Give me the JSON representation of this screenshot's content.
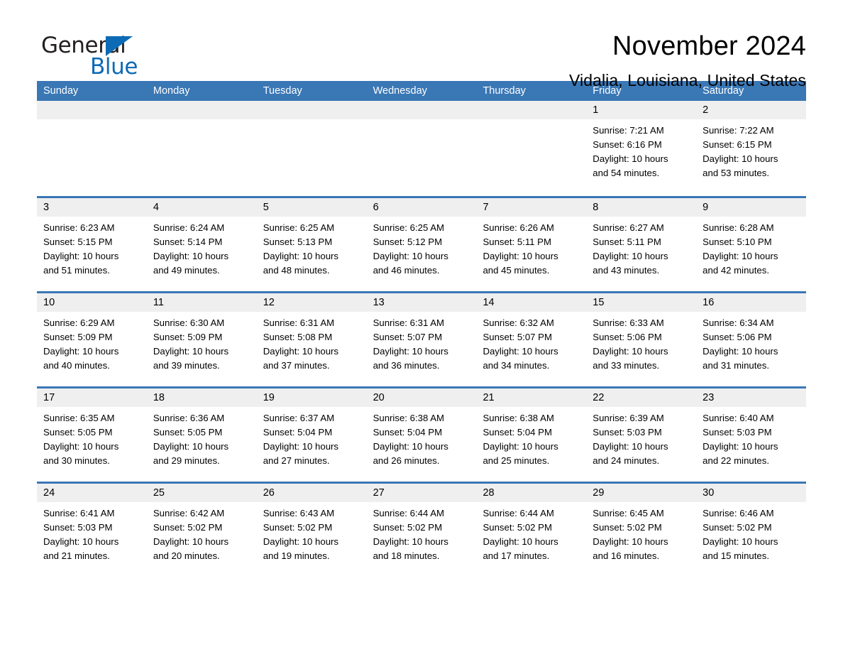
{
  "logo": {
    "word_one": "General",
    "word_two": "Blue",
    "triangle_icon": "blue-triangle-icon",
    "colors": {
      "black": "#231f20",
      "blue": "#0d6bb5"
    }
  },
  "header": {
    "title": "November 2024",
    "location": "Vidalia, Louisiana, United States"
  },
  "theme": {
    "header_bg": "#3a77b5",
    "header_text": "#ffffff",
    "daynum_bg": "#efefef",
    "cell_bg": "#ffffff",
    "text": "#000000"
  },
  "calendar": {
    "weekday_headers": [
      "Sunday",
      "Monday",
      "Tuesday",
      "Wednesday",
      "Thursday",
      "Friday",
      "Saturday"
    ],
    "weeks": [
      [
        {
          "day": "",
          "lines": []
        },
        {
          "day": "",
          "lines": []
        },
        {
          "day": "",
          "lines": []
        },
        {
          "day": "",
          "lines": []
        },
        {
          "day": "",
          "lines": []
        },
        {
          "day": "1",
          "lines": [
            "Sunrise: 7:21 AM",
            "Sunset: 6:16 PM",
            "Daylight: 10 hours",
            "and 54 minutes."
          ]
        },
        {
          "day": "2",
          "lines": [
            "Sunrise: 7:22 AM",
            "Sunset: 6:15 PM",
            "Daylight: 10 hours",
            "and 53 minutes."
          ]
        }
      ],
      [
        {
          "day": "3",
          "lines": [
            "Sunrise: 6:23 AM",
            "Sunset: 5:15 PM",
            "Daylight: 10 hours",
            "and 51 minutes."
          ]
        },
        {
          "day": "4",
          "lines": [
            "Sunrise: 6:24 AM",
            "Sunset: 5:14 PM",
            "Daylight: 10 hours",
            "and 49 minutes."
          ]
        },
        {
          "day": "5",
          "lines": [
            "Sunrise: 6:25 AM",
            "Sunset: 5:13 PM",
            "Daylight: 10 hours",
            "and 48 minutes."
          ]
        },
        {
          "day": "6",
          "lines": [
            "Sunrise: 6:25 AM",
            "Sunset: 5:12 PM",
            "Daylight: 10 hours",
            "and 46 minutes."
          ]
        },
        {
          "day": "7",
          "lines": [
            "Sunrise: 6:26 AM",
            "Sunset: 5:11 PM",
            "Daylight: 10 hours",
            "and 45 minutes."
          ]
        },
        {
          "day": "8",
          "lines": [
            "Sunrise: 6:27 AM",
            "Sunset: 5:11 PM",
            "Daylight: 10 hours",
            "and 43 minutes."
          ]
        },
        {
          "day": "9",
          "lines": [
            "Sunrise: 6:28 AM",
            "Sunset: 5:10 PM",
            "Daylight: 10 hours",
            "and 42 minutes."
          ]
        }
      ],
      [
        {
          "day": "10",
          "lines": [
            "Sunrise: 6:29 AM",
            "Sunset: 5:09 PM",
            "Daylight: 10 hours",
            "and 40 minutes."
          ]
        },
        {
          "day": "11",
          "lines": [
            "Sunrise: 6:30 AM",
            "Sunset: 5:09 PM",
            "Daylight: 10 hours",
            "and 39 minutes."
          ]
        },
        {
          "day": "12",
          "lines": [
            "Sunrise: 6:31 AM",
            "Sunset: 5:08 PM",
            "Daylight: 10 hours",
            "and 37 minutes."
          ]
        },
        {
          "day": "13",
          "lines": [
            "Sunrise: 6:31 AM",
            "Sunset: 5:07 PM",
            "Daylight: 10 hours",
            "and 36 minutes."
          ]
        },
        {
          "day": "14",
          "lines": [
            "Sunrise: 6:32 AM",
            "Sunset: 5:07 PM",
            "Daylight: 10 hours",
            "and 34 minutes."
          ]
        },
        {
          "day": "15",
          "lines": [
            "Sunrise: 6:33 AM",
            "Sunset: 5:06 PM",
            "Daylight: 10 hours",
            "and 33 minutes."
          ]
        },
        {
          "day": "16",
          "lines": [
            "Sunrise: 6:34 AM",
            "Sunset: 5:06 PM",
            "Daylight: 10 hours",
            "and 31 minutes."
          ]
        }
      ],
      [
        {
          "day": "17",
          "lines": [
            "Sunrise: 6:35 AM",
            "Sunset: 5:05 PM",
            "Daylight: 10 hours",
            "and 30 minutes."
          ]
        },
        {
          "day": "18",
          "lines": [
            "Sunrise: 6:36 AM",
            "Sunset: 5:05 PM",
            "Daylight: 10 hours",
            "and 29 minutes."
          ]
        },
        {
          "day": "19",
          "lines": [
            "Sunrise: 6:37 AM",
            "Sunset: 5:04 PM",
            "Daylight: 10 hours",
            "and 27 minutes."
          ]
        },
        {
          "day": "20",
          "lines": [
            "Sunrise: 6:38 AM",
            "Sunset: 5:04 PM",
            "Daylight: 10 hours",
            "and 26 minutes."
          ]
        },
        {
          "day": "21",
          "lines": [
            "Sunrise: 6:38 AM",
            "Sunset: 5:04 PM",
            "Daylight: 10 hours",
            "and 25 minutes."
          ]
        },
        {
          "day": "22",
          "lines": [
            "Sunrise: 6:39 AM",
            "Sunset: 5:03 PM",
            "Daylight: 10 hours",
            "and 24 minutes."
          ]
        },
        {
          "day": "23",
          "lines": [
            "Sunrise: 6:40 AM",
            "Sunset: 5:03 PM",
            "Daylight: 10 hours",
            "and 22 minutes."
          ]
        }
      ],
      [
        {
          "day": "24",
          "lines": [
            "Sunrise: 6:41 AM",
            "Sunset: 5:03 PM",
            "Daylight: 10 hours",
            "and 21 minutes."
          ]
        },
        {
          "day": "25",
          "lines": [
            "Sunrise: 6:42 AM",
            "Sunset: 5:02 PM",
            "Daylight: 10 hours",
            "and 20 minutes."
          ]
        },
        {
          "day": "26",
          "lines": [
            "Sunrise: 6:43 AM",
            "Sunset: 5:02 PM",
            "Daylight: 10 hours",
            "and 19 minutes."
          ]
        },
        {
          "day": "27",
          "lines": [
            "Sunrise: 6:44 AM",
            "Sunset: 5:02 PM",
            "Daylight: 10 hours",
            "and 18 minutes."
          ]
        },
        {
          "day": "28",
          "lines": [
            "Sunrise: 6:44 AM",
            "Sunset: 5:02 PM",
            "Daylight: 10 hours",
            "and 17 minutes."
          ]
        },
        {
          "day": "29",
          "lines": [
            "Sunrise: 6:45 AM",
            "Sunset: 5:02 PM",
            "Daylight: 10 hours",
            "and 16 minutes."
          ]
        },
        {
          "day": "30",
          "lines": [
            "Sunrise: 6:46 AM",
            "Sunset: 5:02 PM",
            "Daylight: 10 hours",
            "and 15 minutes."
          ]
        }
      ]
    ]
  }
}
